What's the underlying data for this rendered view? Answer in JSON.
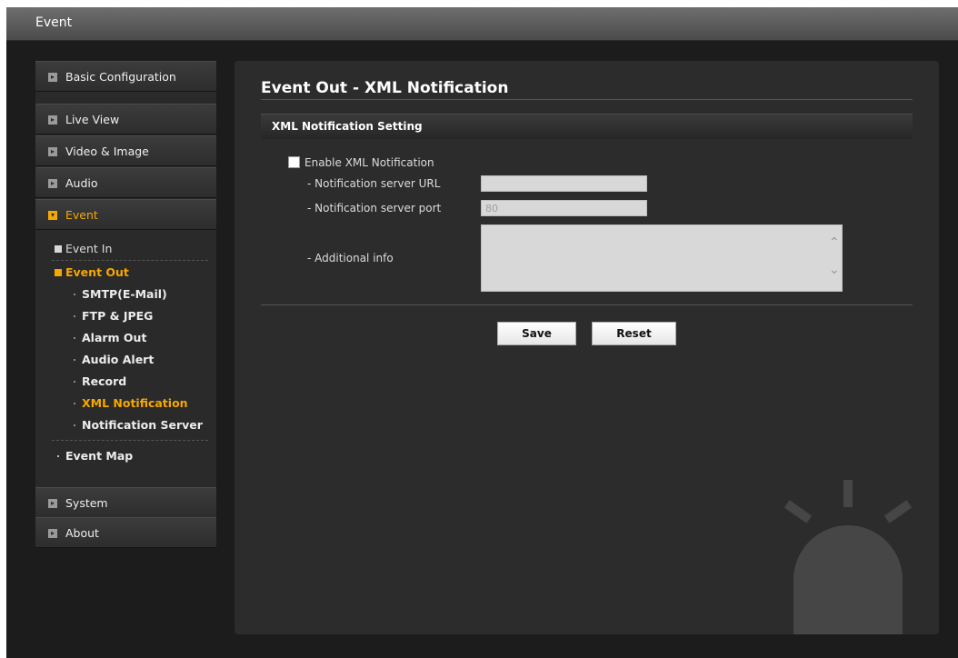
{
  "window": {
    "title": "Event"
  },
  "sidebar": {
    "top_items": [
      {
        "label": "Basic Configuration"
      },
      {
        "label": "Live View"
      },
      {
        "label": "Video & Image"
      },
      {
        "label": "Audio"
      },
      {
        "label": "Event"
      }
    ],
    "event_sub": {
      "event_in": "Event In",
      "event_out": "Event Out",
      "leaves": [
        {
          "label": "SMTP(E-Mail)"
        },
        {
          "label": "FTP & JPEG"
        },
        {
          "label": "Alarm Out"
        },
        {
          "label": "Audio Alert"
        },
        {
          "label": "Record"
        },
        {
          "label": "XML Notification"
        },
        {
          "label": "Notification Server"
        }
      ],
      "event_map": "Event Map"
    },
    "bottom_items": [
      {
        "label": "System"
      },
      {
        "label": "About"
      }
    ],
    "active_color": "#f5a800"
  },
  "main": {
    "title": "Event Out - XML Notification",
    "section": "XML Notification Setting",
    "enable_label": "Enable XML Notification",
    "enable_checked": false,
    "url_label": "- Notification server URL",
    "url_value": "",
    "port_label": "- Notification server port",
    "port_value": "80",
    "info_label": "- Additional info",
    "info_value": "",
    "save_label": "Save",
    "reset_label": "Reset"
  }
}
